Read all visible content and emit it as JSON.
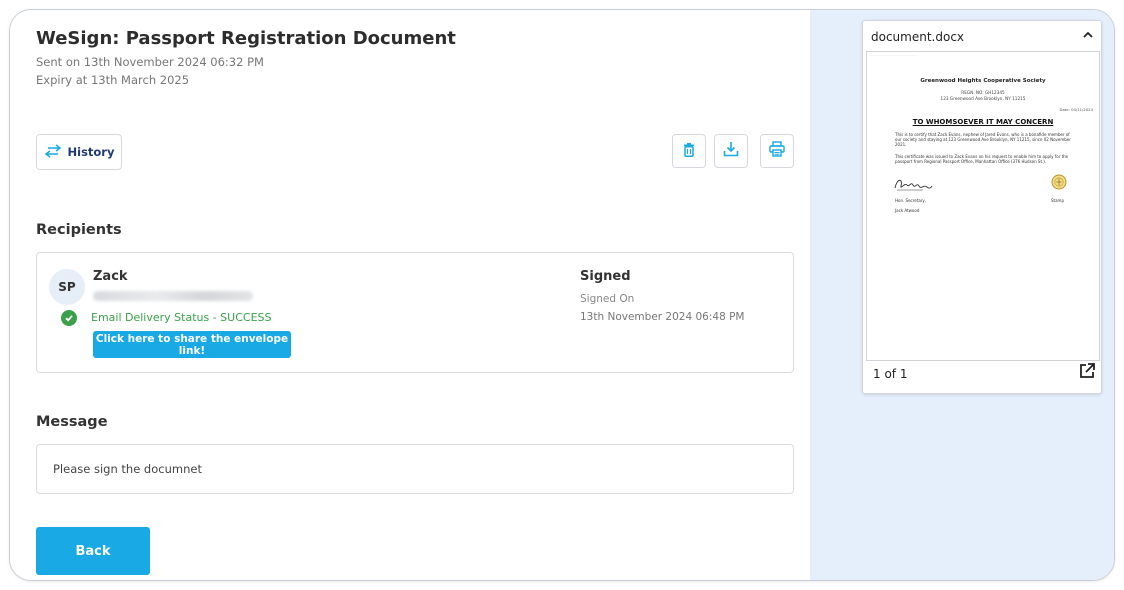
{
  "header": {
    "title": "WeSign: Passport Registration Document",
    "sent": "Sent on 13th November 2024 06:32 PM",
    "expiry": "Expiry at 13th March 2025"
  },
  "toolbar": {
    "history_label": "History",
    "icons": [
      "history-arrows-icon",
      "trash-icon",
      "download-icon",
      "printer-icon"
    ]
  },
  "recipients": {
    "heading": "Recipients",
    "items": [
      {
        "initials": "SP",
        "name": "Zack",
        "email": "",
        "delivery_status": "Email Delivery Status - SUCCESS",
        "share_label": "Click here to share the envelope link!",
        "status": "Signed",
        "signed_on_label": "Signed On",
        "signed_on": "13th November 2024 06:48 PM"
      }
    ]
  },
  "message": {
    "heading": "Message",
    "text": "Please sign the documnet"
  },
  "back_label": "Back",
  "preview": {
    "file_name": "document.docx",
    "page_count": "1 of 1",
    "page": {
      "society": "Greenwood Heights Cooperative Society",
      "reg": "REGN. NO: GH12345",
      "address": "123 Greenwood Ave Brooklyn, NY 11215",
      "date": "Date: 04/11/2024",
      "heading": "TO WHOMSOEVER IT MAY CONCERN",
      "para1": "This is to certify that Zack Evans, nephew of Jared Evans, who is a bonafide member of our society and staying at 123 Greenwood Ave Brooklyn, NY 11215, since 02 November 2021.",
      "para2": "This certificate was issued to Zack Evans on his request to enable him to apply for the passport from Regional Passport Office, Manhattan Office (376 Hudson St.).",
      "sign_label": "Hon. Secretary,",
      "stamp_label": "Stamp",
      "signer": "Jack Atwood"
    }
  },
  "colors": {
    "accent": "#19a9e4",
    "success": "#3aa14a",
    "panel": "#e5effc",
    "nav_text": "#1f3b73"
  }
}
